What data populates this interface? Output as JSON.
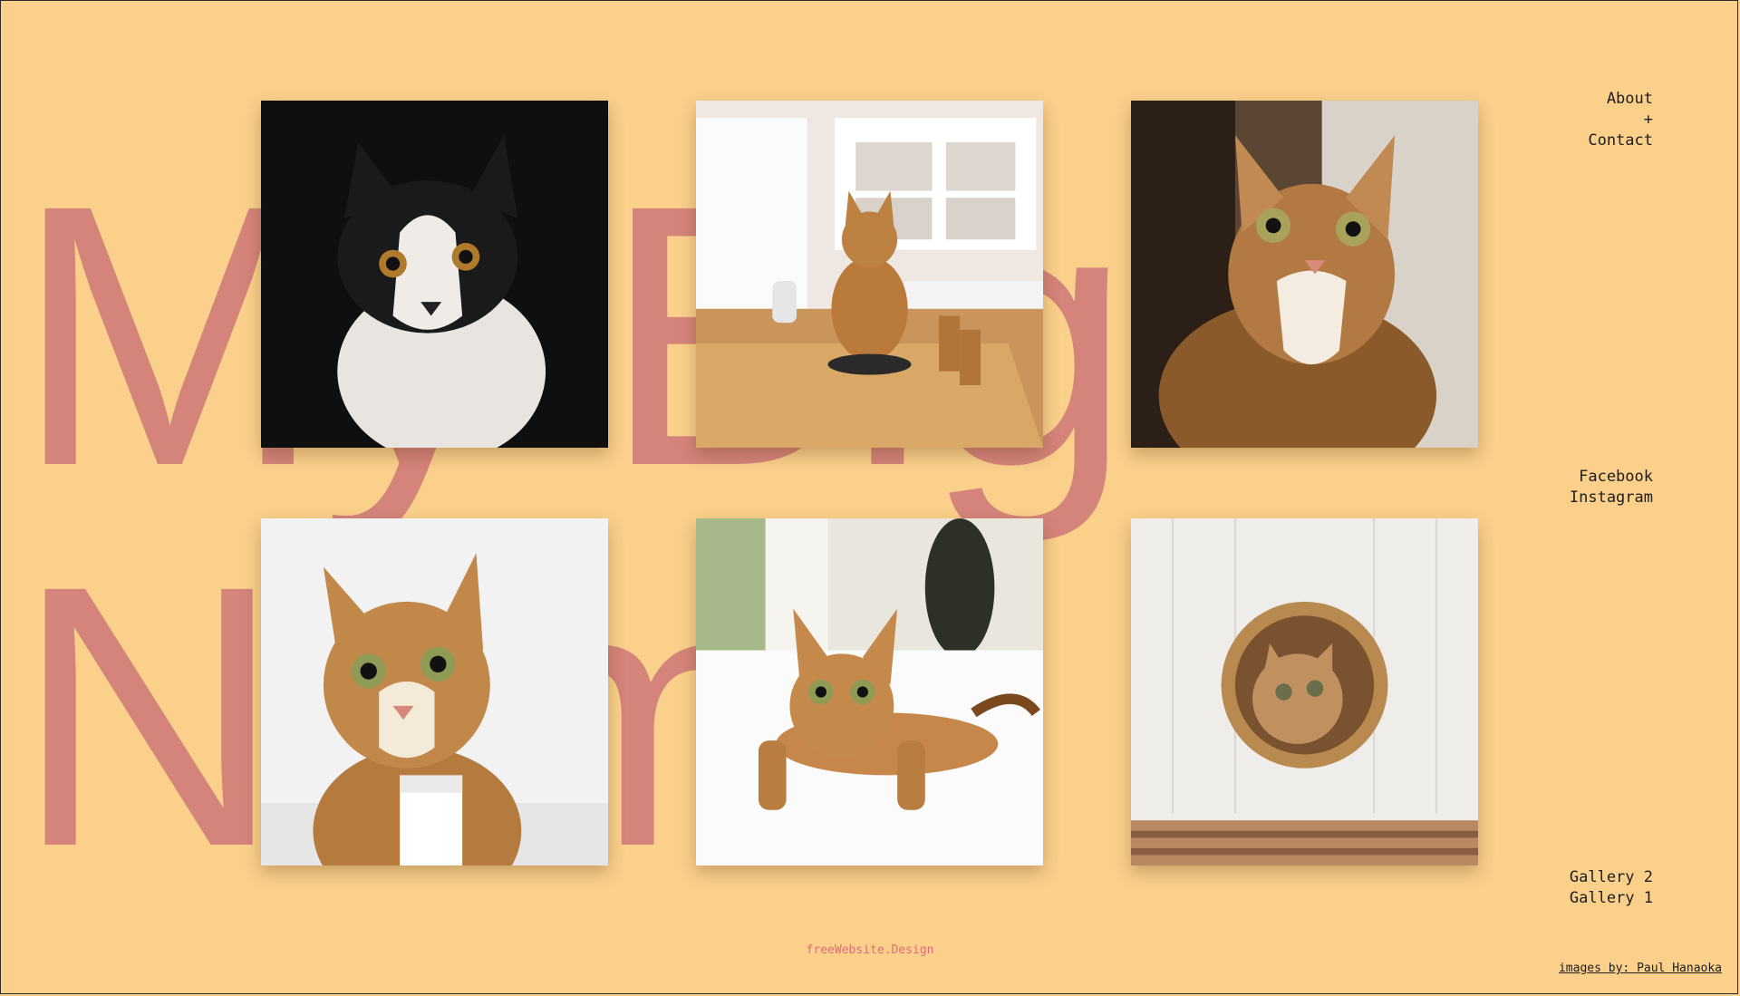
{
  "title": {
    "line1": "My Big",
    "line2": "Name"
  },
  "nav": {
    "about": "About",
    "plus": "+",
    "contact": "Contact",
    "facebook": "Facebook",
    "instagram": "Instagram",
    "gallery2": "Gallery 2",
    "gallery1": "Gallery 1"
  },
  "footer": {
    "brand": "freeWebsite.Design",
    "credits": "images by: Paul Hanaoka"
  },
  "colors": {
    "background": "#FAD08B",
    "title": "#D4847A",
    "brand": "#e06b78"
  },
  "gallery": [
    {
      "subject": "black-and-white cat"
    },
    {
      "subject": "cat on wooden table"
    },
    {
      "subject": "tabby cat looking up"
    },
    {
      "subject": "cat close-up"
    },
    {
      "subject": "cat lying on bed"
    },
    {
      "subject": "cat in basket"
    }
  ]
}
